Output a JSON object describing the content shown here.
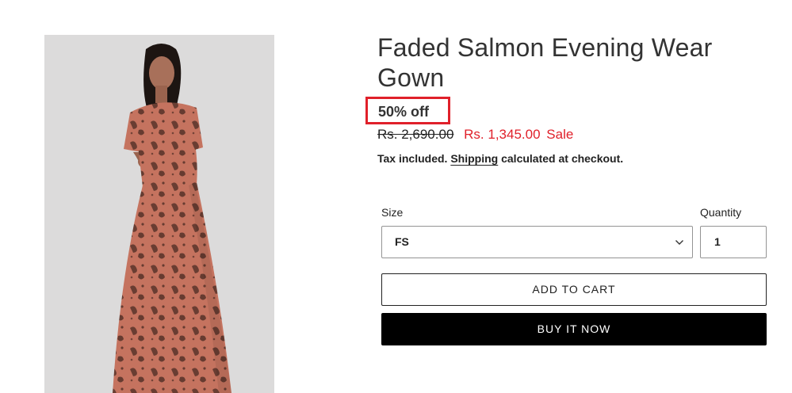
{
  "product": {
    "title": "Faded Salmon Evening Wear Gown",
    "discount_badge": "50% off",
    "price_original": "Rs. 2,690.00",
    "price_sale": "Rs. 1,345.00",
    "sale_label": "Sale",
    "tax_prefix": "Tax included.",
    "shipping_link": "Shipping",
    "tax_suffix": "calculated at checkout.",
    "image_icon": "product-photo-gown"
  },
  "options": {
    "size_label": "Size",
    "size_value": "FS",
    "quantity_label": "Quantity",
    "quantity_value": "1"
  },
  "buttons": {
    "add_to_cart": "ADD TO CART",
    "buy_now": "BUY IT NOW"
  },
  "colors": {
    "sale_red": "#e0202a",
    "badge_border": "#e0202a",
    "buy_button_bg": "#000000"
  }
}
